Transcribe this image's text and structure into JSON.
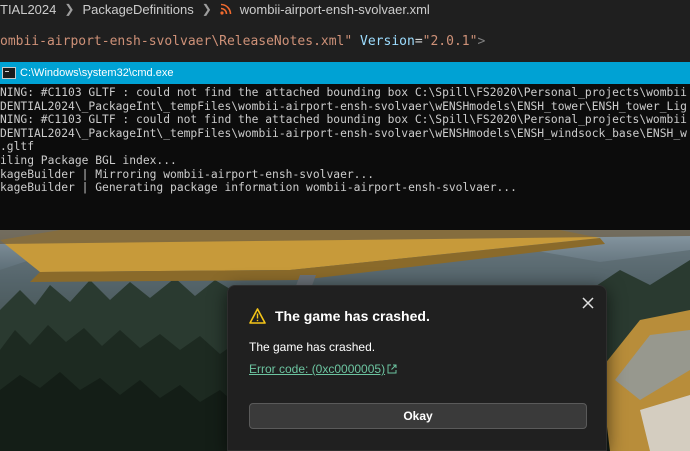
{
  "editor": {
    "breadcrumb": [
      "TIAL2024",
      "PackageDefinitions",
      "wombii-airport-ensh-svolvaer.xml"
    ],
    "code": {
      "path_string": "ombii-airport-ensh-svolvaer\\ReleaseNotes.xml\"",
      "attr_name": "Version",
      "equals": "=",
      "attr_value": "\"2.0.1\"",
      "tag_close": ">"
    }
  },
  "cmd": {
    "title": "C:\\Windows\\system32\\cmd.exe",
    "lines": [
      "NING: #C1103 GLTF : could not find the attached bounding box C:\\Spill\\FS2020\\Personal_projects\\wombii",
      "DENTIAL2024\\_PackageInt\\_tempFiles\\wombii-airport-ensh-svolvaer\\wENSHmodels\\ENSH_tower\\ENSH_tower_Lig",
      "NING: #C1103 GLTF : could not find the attached bounding box C:\\Spill\\FS2020\\Personal_projects\\wombii",
      "DENTIAL2024\\_PackageInt\\_tempFiles\\wombii-airport-ensh-svolvaer\\wENSHmodels\\ENSH_windsock_base\\ENSH_w",
      ".gltf",
      "iling Package BGL index...",
      "kageBuilder | Mirroring wombii-airport-ensh-svolvaer...",
      "kageBuilder | Generating package information wombii-airport-ensh-svolvaer..."
    ]
  },
  "dialog": {
    "title": "The game has crashed.",
    "message": "The game has crashed.",
    "error_link": "Error code: (0xc0000005)",
    "okay_label": "Okay"
  },
  "colors": {
    "cmd_titlebar": "#00a2d4",
    "link": "#6cc4a0",
    "warning": "#f5c518"
  },
  "icons": [
    "rss-icon",
    "cmd-icon",
    "warning-icon",
    "close-icon",
    "external-link-icon"
  ]
}
